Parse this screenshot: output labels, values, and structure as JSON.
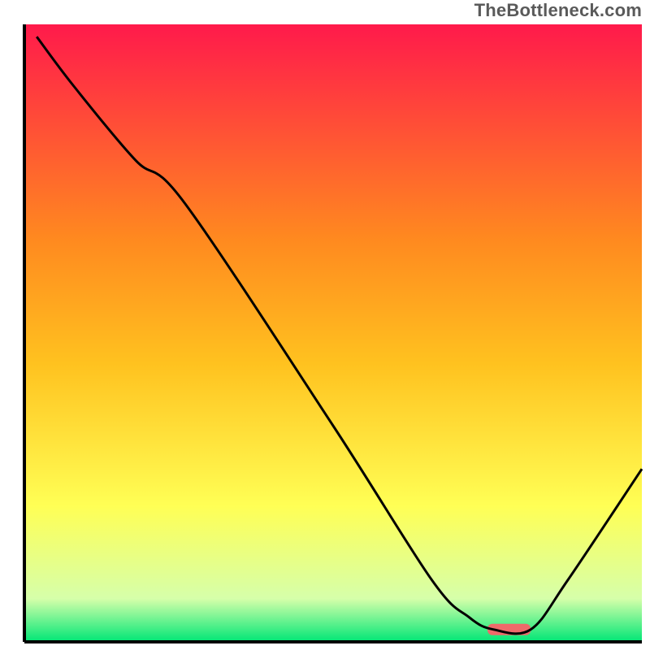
{
  "watermark": "TheBottleneck.com",
  "chart_data": {
    "type": "line",
    "title": "",
    "xlabel": "",
    "ylabel": "",
    "xlim": [
      0,
      100
    ],
    "ylim": [
      0,
      100
    ],
    "grid": false,
    "background_gradient": [
      "#ff1a4b",
      "#ff9a1f",
      "#ffd21f",
      "#ffff55",
      "#d6ffaa",
      "#00e676"
    ],
    "curve": [
      {
        "x": 2,
        "y": 98
      },
      {
        "x": 8,
        "y": 90
      },
      {
        "x": 18,
        "y": 78
      },
      {
        "x": 26,
        "y": 71
      },
      {
        "x": 50,
        "y": 35
      },
      {
        "x": 66,
        "y": 10
      },
      {
        "x": 72,
        "y": 4
      },
      {
        "x": 76,
        "y": 2
      },
      {
        "x": 82,
        "y": 2
      },
      {
        "x": 88,
        "y": 10
      },
      {
        "x": 100,
        "y": 28
      }
    ],
    "marker": {
      "x_start": 75,
      "x_end": 82,
      "y": 2,
      "color": "#ef6a6a"
    }
  }
}
